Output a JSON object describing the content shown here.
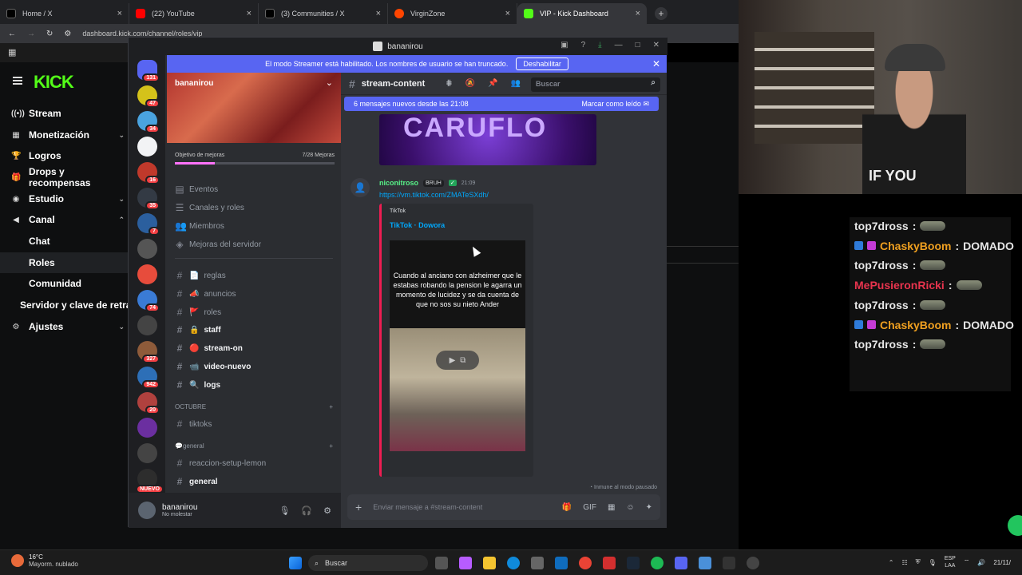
{
  "browser": {
    "tabs": [
      {
        "label": "Home / X",
        "icon": "x-logo-icon",
        "color": "#000000"
      },
      {
        "label": "(22) YouTube",
        "icon": "youtube-icon",
        "color": "#ff0000"
      },
      {
        "label": "(3) Communities / X",
        "icon": "x-logo-icon",
        "color": "#000000"
      },
      {
        "label": "VirginZone",
        "icon": "reddit-icon",
        "color": "#ff4500"
      },
      {
        "label": "VIP - Kick Dashboard",
        "icon": "kick-icon",
        "color": "#53fc18"
      }
    ],
    "url": "dashboard.kick.com/channel/roles/vip"
  },
  "kick": {
    "logo": "KICK",
    "accent": "#53fc18",
    "nav": [
      {
        "label": "Stream",
        "icon": "radio-icon"
      },
      {
        "label": "Monetización",
        "icon": "grid-icon",
        "chevron": true
      },
      {
        "label": "Logros",
        "icon": "trophy-icon"
      },
      {
        "label": "Drops y recompensas",
        "icon": "gift-icon"
      },
      {
        "label": "Estudio",
        "icon": "studio-icon",
        "chevron": true
      },
      {
        "label": "Canal",
        "icon": "channel-icon",
        "chevron": true
      },
      {
        "label": "Chat",
        "sub": true
      },
      {
        "label": "Roles",
        "sub": true,
        "selected": true
      },
      {
        "label": "Comunidad",
        "sub": true
      },
      {
        "label": "Servidor y clave de retran",
        "sub2": true
      },
      {
        "label": "Ajustes",
        "icon": "gear-icon",
        "chevron": true
      }
    ]
  },
  "discord": {
    "window_title": "bananirou",
    "accent": "#5865f2",
    "streamer_banner": {
      "text": "El modo Streamer está habilitado. Los nombres de usuario se han truncado.",
      "button": "Deshabilitar"
    },
    "server_name": "bananirou",
    "guild_badges": [
      "131",
      "47",
      "34",
      "",
      "16",
      "35",
      "7",
      "",
      "",
      "74",
      "",
      "327",
      "942",
      "20",
      "",
      "",
      "NUEVO"
    ],
    "boost": {
      "label": "Objetivo de mejoras",
      "count": "7/28 Mejoras",
      "progress": 0.25
    },
    "menu_items": [
      "Eventos",
      "Canales y roles",
      "Miembros",
      "Mejoras del servidor"
    ],
    "channels": [
      {
        "name": "reglas",
        "prefix": "📄"
      },
      {
        "name": "anuncios",
        "prefix": "📣"
      },
      {
        "name": "roles",
        "prefix": "🚩"
      },
      {
        "name": "staff",
        "prefix": "🔒",
        "bold": true
      },
      {
        "name": "stream-on",
        "prefix": "🔴",
        "bold": true
      },
      {
        "name": "video-nuevo",
        "prefix": "📹",
        "bold": true
      },
      {
        "name": "logs",
        "prefix": "🔍",
        "bold": true
      }
    ],
    "category_octubre": "OCTUBRE",
    "channel_tiktoks": "tiktoks",
    "category_general": "💬general",
    "channel_reaccion": "reaccion-setup-lemon",
    "channel_general": "general",
    "user": {
      "name": "bananirou",
      "status": "No molestar"
    },
    "chat": {
      "channel": "stream-content",
      "search_placeholder": "Buscar",
      "new_messages": "6 mensajes nuevos desde las 21:08",
      "mark_read": "Marcar como leído",
      "top_embed_text": "CARUFLO",
      "message": {
        "author": "niconitroso",
        "tag": "BRUH",
        "time": "21:09",
        "link": "https://vm.tiktok.com/ZMATeSXdh/"
      },
      "embed": {
        "provider": "TikTok",
        "title": "TikTok · Dowora",
        "caption": "Cuando al anciano con alzheimer que le estabas robando la pension le agarra un momento de lucidez y se da cuenta de que no sos su nieto Ander"
      },
      "immune": "Inmune al modo pausado",
      "composer_placeholder": "Enviar mensaje a #stream-content"
    }
  },
  "overlay_chat": {
    "lines": [
      {
        "user": "top7dross",
        "color": "#e6e6e6",
        "text": "",
        "emote": true
      },
      {
        "user": "ChaskyBoom",
        "color": "#f0a020",
        "text": "DOMADO",
        "badges": true
      },
      {
        "user": "top7dross",
        "color": "#e6e6e6",
        "text": "",
        "emote": true
      },
      {
        "user": "MePusieronRicki",
        "color": "#e8344e",
        "text": "",
        "emote": true
      },
      {
        "user": "top7dross",
        "color": "#e6e6e6",
        "text": "",
        "emote": true
      },
      {
        "user": "ChaskyBoom",
        "color": "#f0a020",
        "text": "DOMADO",
        "badges": true
      },
      {
        "user": "top7dross",
        "color": "#e6e6e6",
        "text": "",
        "emote": true
      }
    ]
  },
  "webcam": {
    "shirt_text": "IF YOU"
  },
  "taskbar": {
    "weather_temp": "16°C",
    "weather_desc": "Mayorm. nublado",
    "search": "Buscar",
    "lang_top": "ESP",
    "lang_bottom": "LAA",
    "clock": "21/11/"
  }
}
